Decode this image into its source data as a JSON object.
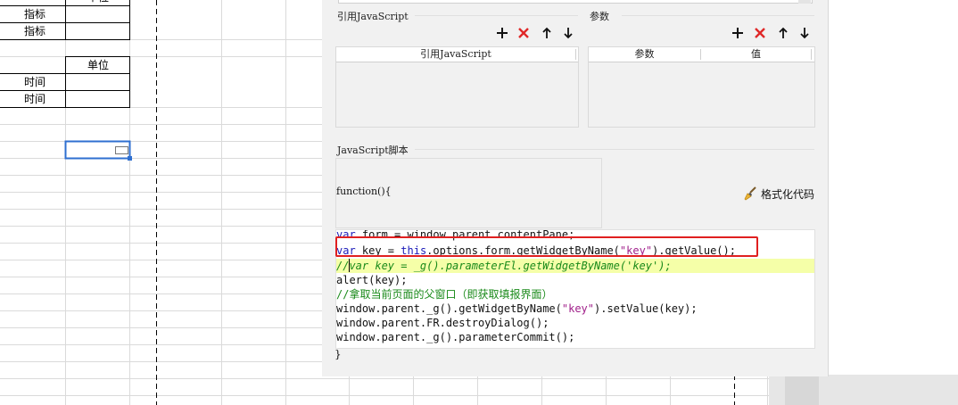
{
  "spreadsheet": {
    "cells": [
      {
        "id": "a-indicator-1",
        "text": "指标"
      },
      {
        "id": "a-indicator-2",
        "text": "指标"
      },
      {
        "id": "b-unit-top",
        "text": "单位"
      },
      {
        "id": "b-unit",
        "text": "单位"
      },
      {
        "id": "a-time-1",
        "text": "时间"
      },
      {
        "id": "a-time-2",
        "text": "时间"
      }
    ]
  },
  "dialog": {
    "referenced_js": {
      "title": "引用JavaScript",
      "column_header": "引用JavaScript"
    },
    "parameters": {
      "title": "参数",
      "column_param": "参数",
      "column_value": "值"
    },
    "toolbar_icons": [
      "add-icon",
      "delete-icon",
      "arrow-up-icon",
      "arrow-down-icon"
    ],
    "script": {
      "title": "JavaScript脚本",
      "function_header": "function(){",
      "format_button_label": "格式化代码",
      "closing_brace": "}",
      "lines": [
        "var form = window.parent.contentPane;",
        "var key = this.options.form.getWidgetByName(\"key\").getValue();",
        "//var key = _g().parameterEl.getWidgetByName('key');",
        "alert(key);",
        "//拿取当前页面的父窗口（即获取填报界面）",
        "window.parent._g().getWidgetByName(\"key\").setValue(key);",
        "window.parent.FR.destroyDialog();",
        "window.parent._g().parameterCommit();"
      ]
    }
  },
  "colors": {
    "highlight_box": "#e02020",
    "current_line_bg": "#f5ffa8",
    "selection_border": "#2f6fd0",
    "delete_red": "#e02828"
  }
}
